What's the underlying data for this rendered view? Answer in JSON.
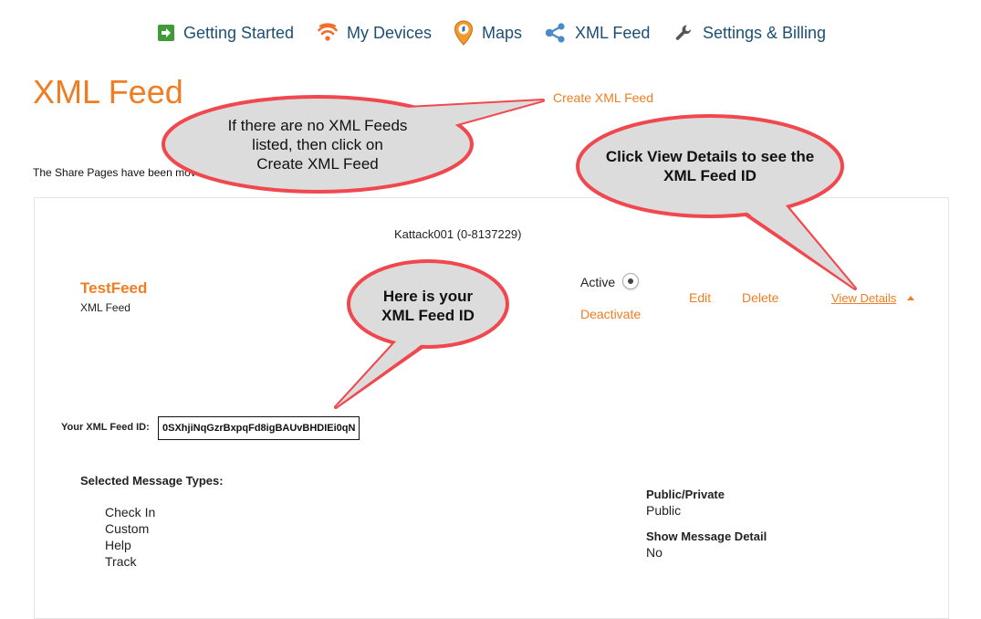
{
  "nav": {
    "items": [
      {
        "label": "Getting Started",
        "icon": "arrow-right-square-icon"
      },
      {
        "label": "My Devices",
        "icon": "wifi-signal-icon"
      },
      {
        "label": "Maps",
        "icon": "map-pin-icon"
      },
      {
        "label": "XML Feed",
        "icon": "share-icon"
      },
      {
        "label": "Settings & Billing",
        "icon": "wrench-icon"
      }
    ]
  },
  "page": {
    "title": "XML Feed",
    "create_link": "Create XML Feed",
    "share_note": "The Share Pages have been moved"
  },
  "feed": {
    "account": "Kattack001 (0-8137229)",
    "name": "TestFeed",
    "type": "XML Feed",
    "status": "Active",
    "deactivate_label": "Deactivate",
    "edit_label": "Edit",
    "delete_label": "Delete",
    "view_details_label": "View Details",
    "feed_id_label": "Your XML Feed ID:",
    "feed_id": "0SXhjiNqGzrBxpqFd8igBAUvBHDIEi0qN",
    "message_types_heading": "Selected Message Types:",
    "message_types": [
      "Check In",
      "Custom",
      "Help",
      "Track"
    ],
    "public_private_label": "Public/Private",
    "public_private_value": "Public",
    "show_message_detail_label": "Show Message Detail",
    "show_message_detail_value": "No"
  },
  "callouts": {
    "no_feeds": [
      "If there are no XML Feeds",
      "listed, then click on",
      "Create XML Feed"
    ],
    "view_details": [
      "Click View Details to see the",
      "XML Feed ID"
    ],
    "feed_id": [
      "Here is your",
      "XML Feed ID"
    ]
  },
  "colors": {
    "accent": "#f07d22",
    "nav_text": "#1d4f73",
    "callout_fill": "#dcdcdc",
    "callout_stroke": "#f0484e"
  }
}
